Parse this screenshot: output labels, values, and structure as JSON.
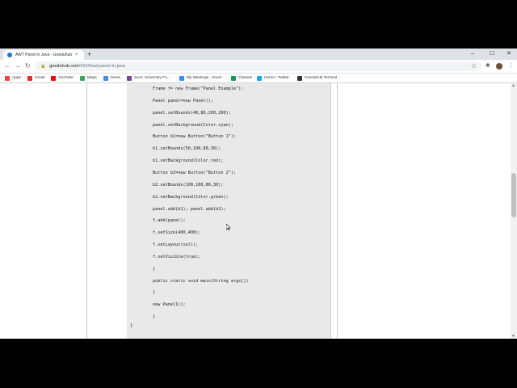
{
  "tab": {
    "title": "AWT Panel in Java - Goeduhub T",
    "close": "×"
  },
  "new_tab": "+",
  "window_controls": {
    "minimize": "–",
    "maximize": "☐",
    "close": "✕"
  },
  "toolbar": {
    "back": "←",
    "forward": "→",
    "reload": "↻",
    "url_host": "goeduhub.com",
    "url_path": "/4234/awt-panel-in-java",
    "star": "☆",
    "extensions": "✱",
    "menu": "⋮"
  },
  "bookmarks": [
    {
      "label": "Apps",
      "color": "#e8453c"
    },
    {
      "label": "Gmail",
      "color": "#d93025"
    },
    {
      "label": "YouTube",
      "color": "#ff0000"
    },
    {
      "label": "Maps",
      "color": "#34a853"
    },
    {
      "label": "News",
      "color": "#4285f4"
    },
    {
      "label": "Jecrc University Fo...",
      "color": "#7a3e9d"
    },
    {
      "label": "My Meetings - Zoom",
      "color": "#2d8cff"
    },
    {
      "label": "Classes",
      "color": "#0f9d58"
    },
    {
      "label": "Home / Twitter",
      "color": "#1da1f2"
    },
    {
      "label": "Goeduhub Technol...",
      "color": "#333333"
    }
  ],
  "code": {
    "lines": [
      "Frame f= new Frame(\"Panel Example\");",
      "Panel panel=new Panel();",
      "panel.setBounds(40,80,200,200);",
      "panel.setBackground(Color.cyan);",
      "Button b1=new Button(\"Button 1\");",
      "b1.setBounds(50,100,80,30);",
      "b1.setBackground(Color.red);",
      "Button b2=new Button(\"Button 2\");",
      "b2.setBounds(100,100,80,30);",
      "b2.setBackground(Color.green);",
      "panel.add(b1); panel.add(b2);",
      "f.add(panel);",
      "f.setSize(400,400);",
      "f.setLayout(null);",
      "f.setVisible(true);",
      "}",
      "public static void main(String args[])",
      "{",
      "new Panel1();",
      "}"
    ],
    "closing_brace": "}"
  },
  "scrollbar": {
    "up": "▲",
    "down": "▼",
    "position_fraction": 0.42
  }
}
